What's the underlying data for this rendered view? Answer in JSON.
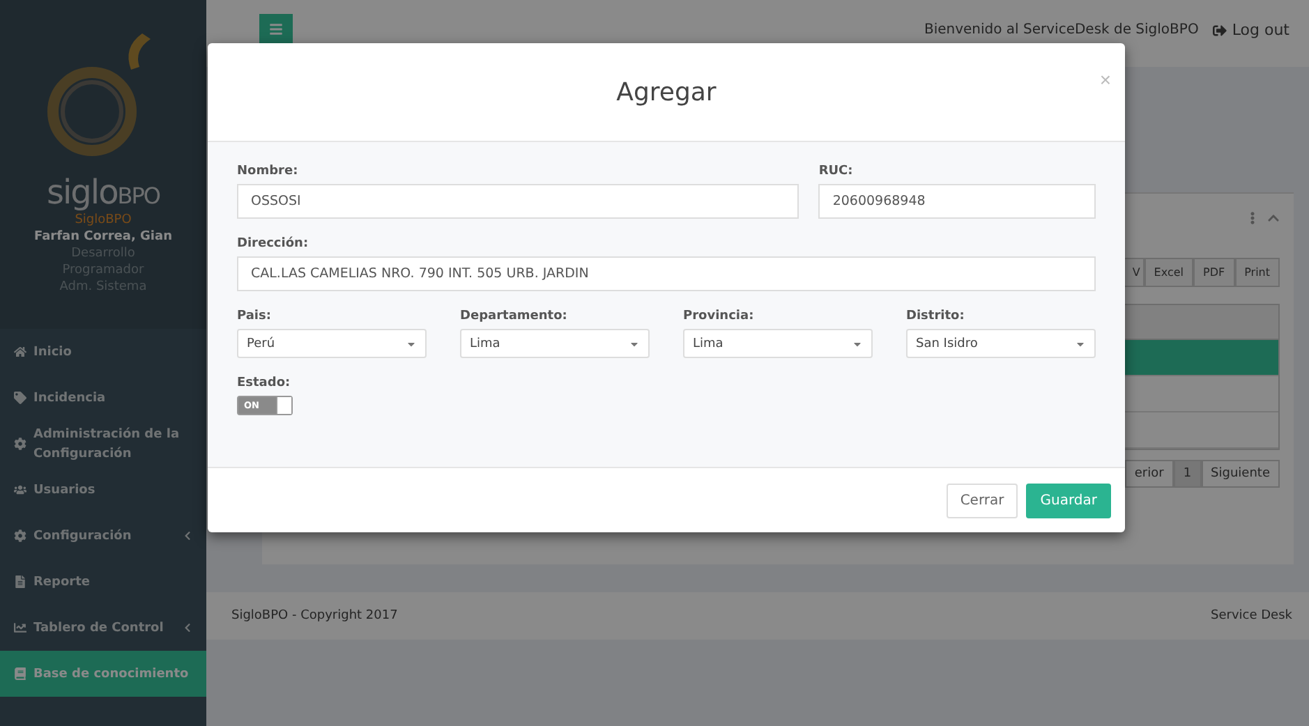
{
  "sidebar": {
    "logo": {
      "name": "siglo",
      "suffix": "BPO"
    },
    "user": {
      "company": "SigloBPO",
      "name": "Farfan Correa, Gian",
      "roles": [
        "Desarrollo",
        "Programador",
        "Adm. Sistema"
      ]
    },
    "items": [
      {
        "label": "Inicio",
        "selected": false,
        "expandable": false
      },
      {
        "label": "Incidencia",
        "selected": false,
        "expandable": false
      },
      {
        "label": "Administración de la Configuración",
        "selected": false,
        "expandable": false
      },
      {
        "label": "Usuarios",
        "selected": false,
        "expandable": false
      },
      {
        "label": "Configuración",
        "selected": false,
        "expandable": true
      },
      {
        "label": "Reporte",
        "selected": false,
        "expandable": false
      },
      {
        "label": "Tablero de Control",
        "selected": false,
        "expandable": true
      },
      {
        "label": "Base de conocimiento",
        "selected": true,
        "expandable": false
      }
    ]
  },
  "header": {
    "welcome": "Bienvenido al ServiceDesk de SigloBPO",
    "logout": "Log out"
  },
  "panel": {
    "export_buttons": [
      "V",
      "Excel",
      "PDF",
      "Print"
    ],
    "rows": [
      {
        "selected": true
      },
      {
        "selected": false
      },
      {
        "selected": false
      }
    ],
    "pagination": [
      {
        "label": "erior",
        "selected": false
      },
      {
        "label": "1",
        "selected": true
      },
      {
        "label": "Siguiente",
        "selected": false
      }
    ]
  },
  "footer": {
    "copyright": "SigloBPO - Copyright 2017",
    "product": "Service Desk"
  },
  "modal": {
    "title": "Agregar",
    "close": "×",
    "rows": [
      [
        {
          "kind": "text",
          "label": "Nombre:",
          "value": "OSSOSI"
        },
        {
          "kind": "text",
          "label": "RUC:",
          "value": "20600968948"
        }
      ],
      [
        {
          "kind": "text",
          "label": "Dirección:",
          "value": "CAL.LAS CAMELIAS NRO. 790 INT. 505 URB. JARDIN"
        }
      ],
      [
        {
          "kind": "select",
          "label": "Pais:",
          "value": "Perú"
        },
        {
          "kind": "select",
          "label": "Departamento:",
          "value": "Lima"
        },
        {
          "kind": "select",
          "label": "Provincia:",
          "value": "Lima"
        },
        {
          "kind": "select",
          "label": "Distrito:",
          "value": "San Isidro"
        }
      ],
      [
        {
          "kind": "switch",
          "label": "Estado:",
          "on": true,
          "on_text": "ON"
        }
      ]
    ],
    "buttons": [
      {
        "label": "Cerrar",
        "kind": "default"
      },
      {
        "label": "Guardar",
        "kind": "primary"
      }
    ]
  }
}
